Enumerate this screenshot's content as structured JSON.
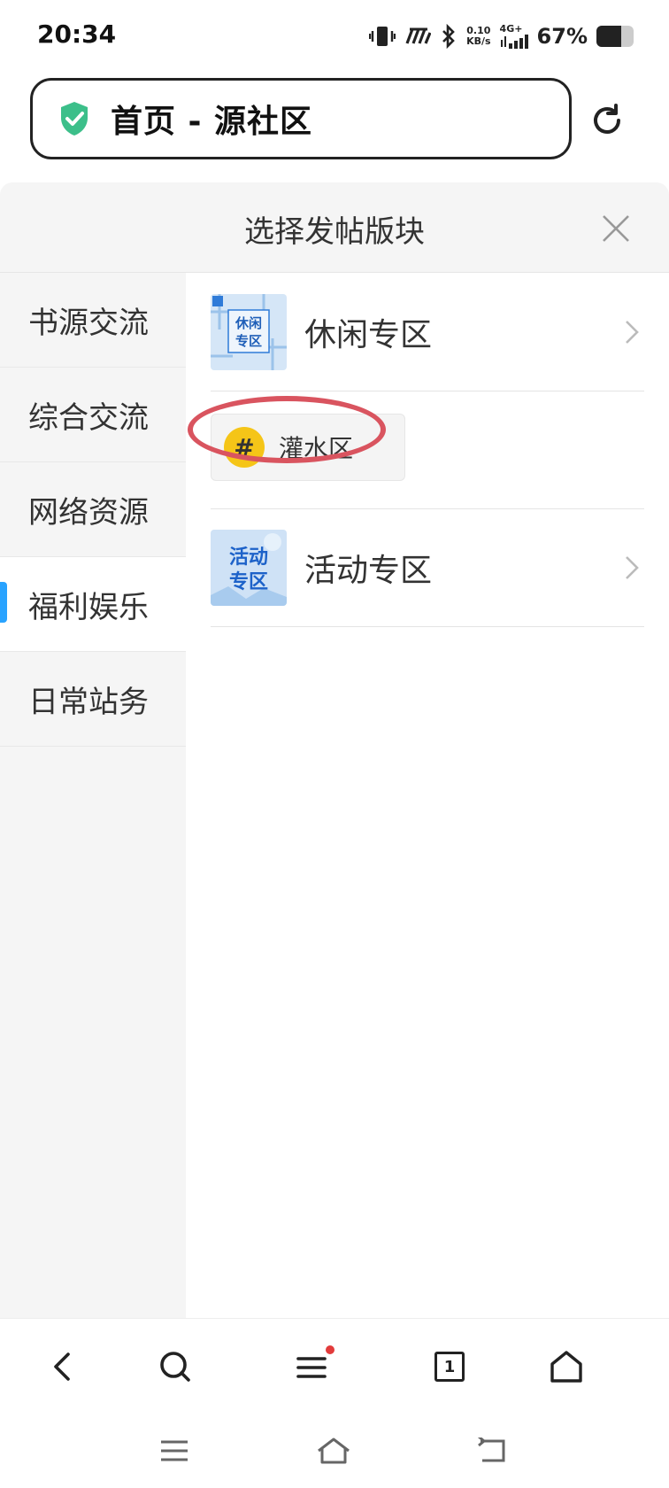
{
  "status_bar": {
    "time": "20:34",
    "net_speed_value": "0.10",
    "net_speed_unit": "KB/s",
    "network_type": "4G+",
    "battery_percent": "67%",
    "battery_level": 0.67
  },
  "address_bar": {
    "title": "首页 - 源社区"
  },
  "sheet": {
    "title": "选择发帖版块"
  },
  "left_nav": {
    "items": [
      {
        "label": "书源交流",
        "active": false
      },
      {
        "label": "综合交流",
        "active": false
      },
      {
        "label": "网络资源",
        "active": false
      },
      {
        "label": "福利娱乐",
        "active": true
      },
      {
        "label": "日常站务",
        "active": false
      }
    ]
  },
  "boards": [
    {
      "name": "休闲专区",
      "thumb_text": [
        "休闲",
        "专区"
      ]
    },
    {
      "name": "活动专区",
      "thumb_text": [
        "活动",
        "专区"
      ]
    }
  ],
  "sub_board": {
    "name": "灌水区",
    "icon": "#"
  },
  "toolbar": {
    "tab_count": "1"
  },
  "colors": {
    "accent": "#29a3ff",
    "highlight": "#d9545f",
    "shield": "#3cbf8a",
    "hash_bg": "#f5c518",
    "notify_dot": "#e23b3b"
  }
}
